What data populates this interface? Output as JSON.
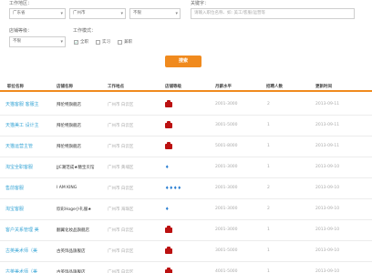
{
  "filters": {
    "location_label": "工作地区：",
    "province": "广东省",
    "city": "广州市",
    "district": "不限",
    "keyword_label": "关键字：",
    "keyword_placeholder": "请输入职位名称、如: 美工/客服/运营等",
    "shop_level_label": "店铺等级：",
    "shop_level": "不限",
    "work_mode_label": "工作模式：",
    "modes": [
      {
        "label": "全职",
        "checked": true
      },
      {
        "label": "实习",
        "checked": false
      },
      {
        "label": "兼职",
        "checked": false
      }
    ],
    "search_button": "搜索"
  },
  "table": {
    "headers": [
      "职位名称",
      "店铺名称",
      "工作地点",
      "店铺等级",
      "月薪水平",
      "招聘人数",
      "更新时间"
    ],
    "rows": [
      {
        "title": "天猫客服  客服主",
        "shop": "拜伦特旗舰店",
        "location": "广州市 白云区",
        "level": "crown",
        "salary": "2001-3000",
        "count": "2",
        "date": "2013-09-11"
      },
      {
        "title": "天猫美工  设计主",
        "shop": "拜伦特旗舰店",
        "location": "广州市 白云区",
        "level": "crown",
        "salary": "3001-5000",
        "count": "1",
        "date": "2013-09-11"
      },
      {
        "title": "天猫运营主管",
        "shop": "拜伦特旗舰店",
        "location": "广州市 白云区",
        "level": "crown",
        "salary": "5001-8000",
        "count": "1",
        "date": "2013-09-11"
      },
      {
        "title": "淘宝全职客服",
        "shop": "JJC潮范成★糖宝贝馆",
        "location": "广州市 黄埔区",
        "level": "diamond1",
        "salary": "2001-3000",
        "count": "1",
        "date": "2013-09-10"
      },
      {
        "title": "售前客服",
        "shop": "I AM KING",
        "location": "广州市 白云区",
        "level": "diamond4",
        "salary": "2001-3000",
        "count": "2",
        "date": "2013-09-10"
      },
      {
        "title": "淘宝客服",
        "shop": "欣彩Hoge小礼服★",
        "location": "广州市 海珠区",
        "level": "diamond1",
        "salary": "2001-3000",
        "count": "2",
        "date": "2013-09-10"
      },
      {
        "title": "客户关系管理  美",
        "shop": "翻翼化妆品旗舰店",
        "location": "广州市 白云区",
        "level": "crown",
        "salary": "2001-3000",
        "count": "1",
        "date": "2013-09-10"
      },
      {
        "title": "古英美术师（美",
        "shop": "古英饰品旗舰店",
        "location": "广州市 白云区",
        "level": "crown",
        "salary": "3001-5000",
        "count": "1",
        "date": "2013-09-10"
      },
      {
        "title": "古英美术师（美",
        "shop": "古英饰品旗舰店",
        "location": "广州市 白云区",
        "level": "crown",
        "salary": "4001-5000",
        "count": "1",
        "date": "2013-09-10"
      }
    ]
  }
}
